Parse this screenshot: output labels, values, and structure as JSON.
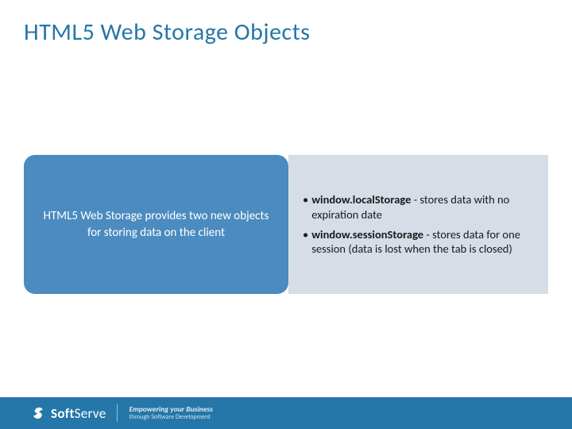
{
  "title": "HTML5 Web Storage Objects",
  "left_box": "HTML5 Web Storage provides two new objects for storing data on the client",
  "bullets": [
    {
      "bold": "window.localStorage",
      "rest": " - stores data with no expiration date"
    },
    {
      "bold": "window.sessionStorage",
      "rest": " - stores data for one session (data is lost when the tab is closed)"
    }
  ],
  "footer": {
    "brand_prefix": "Soft",
    "brand_suffix": "Serve",
    "tagline1": "Empowering your Business",
    "tagline2": "through Software Development"
  }
}
